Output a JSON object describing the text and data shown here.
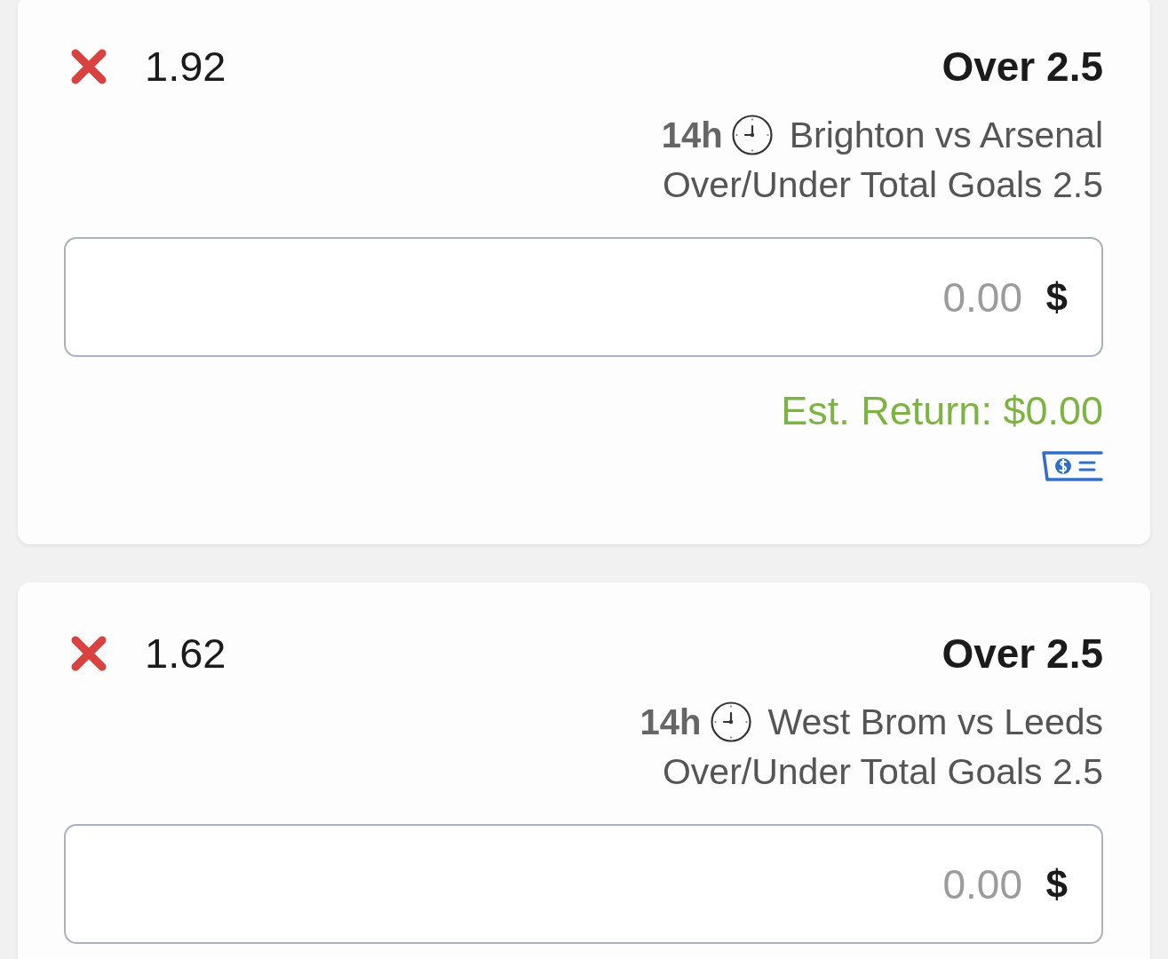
{
  "bets": [
    {
      "odds": "1.92",
      "selection": "Over 2.5",
      "time": "14h",
      "match": "Brighton vs Arsenal",
      "market": "Over/Under Total Goals 2.5",
      "stake": {
        "currency": "$",
        "placeholder": "0.00"
      },
      "est_return": "Est. Return: $0.00"
    },
    {
      "odds": "1.62",
      "selection": "Over 2.5",
      "time": "14h",
      "match": "West Brom vs Leeds",
      "market": "Over/Under Total Goals 2.5",
      "stake": {
        "currency": "$",
        "placeholder": "0.00"
      }
    }
  ]
}
